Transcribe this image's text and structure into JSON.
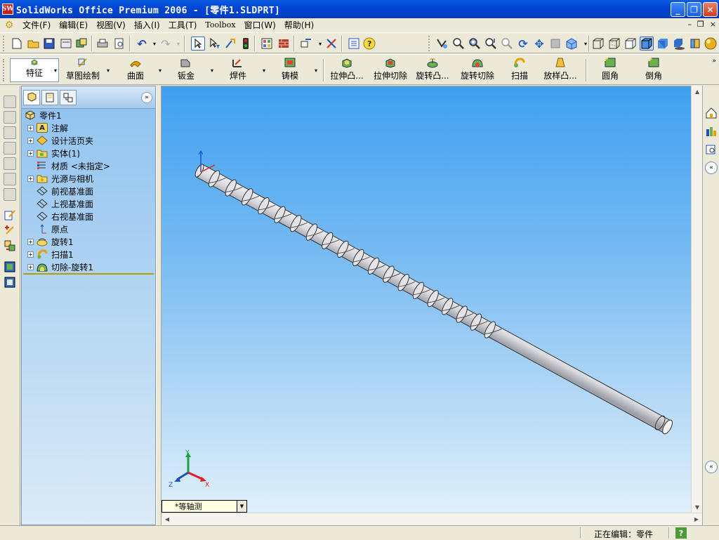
{
  "window": {
    "app_logo_text": "SW",
    "title": "SolidWorks Office Premium 2006 - [零件1.SLDPRT]",
    "minimize": "_",
    "maximize": "❐",
    "close": "✕"
  },
  "menu": {
    "items": [
      "文件(F)",
      "编辑(E)",
      "视图(V)",
      "插入(I)",
      "工具(T)",
      "Toolbox",
      "窗口(W)",
      "帮助(H)"
    ],
    "doc_controls": [
      "–",
      "❐",
      "×"
    ]
  },
  "command_manager": {
    "buttons": [
      {
        "label": "特征"
      },
      {
        "label": "草图绘制"
      },
      {
        "label": "曲面"
      },
      {
        "label": "钣金"
      },
      {
        "label": "焊件"
      },
      {
        "label": "铸模"
      },
      {
        "label": "拉伸凸..."
      },
      {
        "label": "拉伸切除"
      },
      {
        "label": "旋转凸..."
      },
      {
        "label": "旋转切除"
      },
      {
        "label": "扫描"
      },
      {
        "label": "放样凸..."
      },
      {
        "label": "圆角"
      },
      {
        "label": "倒角"
      }
    ]
  },
  "feature_tree": {
    "collapse_button": "»",
    "root": "零件1",
    "items": [
      {
        "label": "注解",
        "expandable": true,
        "icon": "annotation-icon"
      },
      {
        "label": "设计活页夹",
        "expandable": true,
        "icon": "design-binder-icon"
      },
      {
        "label": "实体(1)",
        "expandable": true,
        "icon": "solid-bodies-icon"
      },
      {
        "label": "材质 <未指定>",
        "expandable": false,
        "icon": "material-icon"
      },
      {
        "label": "光源与相机",
        "expandable": true,
        "icon": "lights-cameras-icon"
      },
      {
        "label": "前视基准面",
        "expandable": false,
        "icon": "plane-icon"
      },
      {
        "label": "上视基准面",
        "expandable": false,
        "icon": "plane-icon"
      },
      {
        "label": "右视基准面",
        "expandable": false,
        "icon": "plane-icon"
      },
      {
        "label": "原点",
        "expandable": false,
        "icon": "origin-icon"
      },
      {
        "label": "旋转1",
        "expandable": true,
        "icon": "revolve-icon"
      },
      {
        "label": "扫描1",
        "expandable": true,
        "icon": "sweep-icon"
      },
      {
        "label": "切除-旋转1",
        "expandable": true,
        "icon": "cut-revolve-icon"
      }
    ]
  },
  "viewport": {
    "orientation": "*等轴测",
    "triad": {
      "x": "X",
      "y": "Y",
      "z": "Z"
    }
  },
  "status": {
    "text": "正在编辑：零件",
    "help": "?"
  },
  "colors": {
    "title_bar": "#0046d5",
    "viewport_top": "#3fa0f0",
    "viewport_bottom": "#dff0fb",
    "tree_bg": "#bcdaf3"
  }
}
